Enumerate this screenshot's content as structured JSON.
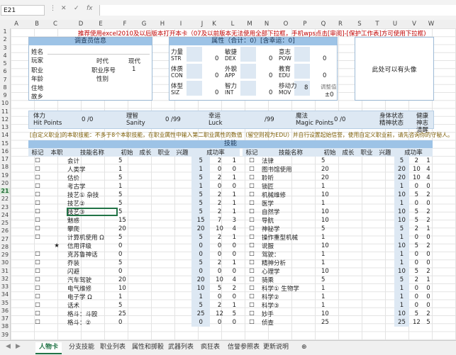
{
  "formula_bar": {
    "name_box": "E21",
    "cancel_icon": "✕",
    "confirm_icon": "✓",
    "fx_label": "fx",
    "formula": ""
  },
  "columns": [
    "A",
    "B",
    "C",
    "D",
    "E",
    "F",
    "G",
    "H",
    "I",
    "J",
    "K",
    "L",
    "M",
    "N",
    "O",
    "P",
    "Q",
    "R",
    "S",
    "T",
    "U",
    "V",
    "W"
  ],
  "rows": [
    "1",
    "2",
    "3",
    "4",
    "5",
    "6",
    "7",
    "8",
    "9",
    "10",
    "11",
    "12",
    "13",
    "14",
    "15",
    "16",
    "17",
    "18",
    "19",
    "20",
    "21",
    "22",
    "23",
    "24",
    "25",
    "26",
    "27",
    "28",
    "29",
    "30",
    "31",
    "32",
    "33",
    "34",
    "35",
    "36",
    "37",
    "38",
    "39"
  ],
  "selected_row": "21",
  "notice": "推荐使用excel2010及以后版本打开本卡（07及以前版本无法使用全部下拉框，手机wps点击[审阅]-[保护工作表]方可使用下拉框)",
  "investigator": {
    "title": "调查员信息",
    "name_label": "姓名",
    "player_label": "玩家",
    "era_label": "时代",
    "era_value": "现代",
    "occupation_label": "职业",
    "occ_seq_label": "职业序号",
    "occ_seq_value": "1",
    "age_label": "年龄",
    "sex_label": "性别",
    "residence_label": "住地",
    "hometown_label": "故乡"
  },
  "attributes": {
    "title": "属性（合计：0）[含幸运：0]",
    "items": [
      {
        "cn": "力量",
        "en": "STR",
        "value": "0"
      },
      {
        "cn": "敏捷",
        "en": "DEX",
        "value": "0"
      },
      {
        "cn": "意志",
        "en": "POW",
        "value": "0"
      },
      {
        "cn": "体质",
        "en": "CON",
        "value": "0"
      },
      {
        "cn": "外貌",
        "en": "APP",
        "value": "0"
      },
      {
        "cn": "教育",
        "en": "EDU",
        "value": "0"
      },
      {
        "cn": "体型",
        "en": "SIZ",
        "value": "0"
      },
      {
        "cn": "智力",
        "en": "INT",
        "value": "0"
      },
      {
        "cn": "移动力",
        "en": "MOV",
        "value": "8"
      }
    ],
    "adjust_label": "调整值",
    "adjust_value": "±0"
  },
  "portrait": {
    "text": "此处可以有头像"
  },
  "status": {
    "hp_cn": "体力",
    "hp_en": "Hit  Points",
    "hp_value": "0 /0",
    "san_cn": "理智",
    "san_en": "Sanity",
    "san_value": "0 /99",
    "luck_cn": "幸运",
    "luck_en": "Luck",
    "luck_value": "/99",
    "mp_cn": "魔法",
    "mp_en": "Magic Points",
    "mp_value": "0 /0",
    "body_label": "身体状态",
    "body_value": "健康",
    "mind_label": "精神状态",
    "mind_value": "神志清醒"
  },
  "custom_notice": "[自定义职业]的本职技能：不多于8个本职技能，在职业属性中输入第二职业属性的数值（留空则视为EDU）并自行设置起始信誉，使用自定义职业前，请先咨询你的守秘人。",
  "skills": {
    "title": "技能",
    "headers": [
      "标记",
      "本职",
      "技能名称",
      "初始",
      "成长",
      "职业",
      "兴趣",
      "成功率"
    ],
    "left": [
      {
        "mark": "☐",
        "occ": "",
        "name": "会计",
        "init": "5",
        "v1": "5",
        "v2": "2",
        "v3": "1"
      },
      {
        "mark": "☐",
        "occ": "",
        "name": "人类学",
        "init": "1",
        "v1": "1",
        "v2": "0",
        "v3": "0"
      },
      {
        "mark": "☐",
        "occ": "",
        "name": "估价",
        "init": "5",
        "v1": "5",
        "v2": "2",
        "v3": "1"
      },
      {
        "mark": "☐",
        "occ": "",
        "name": "考古学",
        "init": "1",
        "v1": "1",
        "v2": "0",
        "v3": "0"
      },
      {
        "mark": "☐",
        "occ": "",
        "name": "技艺① 杂技",
        "init": "5",
        "v1": "5",
        "v2": "2",
        "v3": "1"
      },
      {
        "mark": "☐",
        "occ": "",
        "name": "技艺②",
        "init": "5",
        "v1": "5",
        "v2": "2",
        "v3": "1"
      },
      {
        "mark": "☐",
        "occ": "",
        "name": "技艺③",
        "init": "5",
        "v1": "5",
        "v2": "2",
        "v3": "1"
      },
      {
        "mark": "☐",
        "occ": "",
        "name": "魅惑",
        "init": "15",
        "v1": "15",
        "v2": "7",
        "v3": "3"
      },
      {
        "mark": "☐",
        "occ": "",
        "name": "攀爬",
        "init": "20",
        "v1": "20",
        "v2": "10",
        "v3": "4"
      },
      {
        "mark": "☐",
        "occ": "",
        "name": "计算机使用 Ω",
        "init": "5",
        "v1": "5",
        "v2": "2",
        "v3": "1"
      },
      {
        "mark": "",
        "occ": "★",
        "name": "信用评级",
        "init": "0",
        "v1": "0",
        "v2": "0",
        "v3": "0"
      },
      {
        "mark": "☐",
        "occ": "",
        "name": "克苏鲁神话",
        "init": "0",
        "v1": "0",
        "v2": "0",
        "v3": "0"
      },
      {
        "mark": "☐",
        "occ": "",
        "name": "乔装",
        "init": "5",
        "v1": "5",
        "v2": "2",
        "v3": "1"
      },
      {
        "mark": "☐",
        "occ": "",
        "name": "闪避",
        "init": "0",
        "v1": "0",
        "v2": "0",
        "v3": "0"
      },
      {
        "mark": "☐",
        "occ": "",
        "name": "汽车驾驶",
        "init": "20",
        "v1": "20",
        "v2": "10",
        "v3": "4"
      },
      {
        "mark": "☐",
        "occ": "",
        "name": "电气维修",
        "init": "10",
        "v1": "10",
        "v2": "5",
        "v3": "2"
      },
      {
        "mark": "☐",
        "occ": "",
        "name": "电子学 Ω",
        "init": "1",
        "v1": "1",
        "v2": "0",
        "v3": "0"
      },
      {
        "mark": "☐",
        "occ": "",
        "name": "话术",
        "init": "5",
        "v1": "5",
        "v2": "2",
        "v3": "1"
      },
      {
        "mark": "☐",
        "occ": "",
        "name": "格斗：斗殴",
        "init": "25",
        "v1": "25",
        "v2": "12",
        "v3": "5"
      },
      {
        "mark": "☐",
        "occ": "",
        "name": "格斗：②",
        "init": "0",
        "v1": "0",
        "v2": "0",
        "v3": "0"
      }
    ],
    "right": [
      {
        "mark": "☐",
        "name": "法律",
        "init": "5",
        "v1": "5",
        "v2": "2",
        "v3": "1"
      },
      {
        "mark": "☐",
        "name": "图书馆使用",
        "init": "20",
        "v1": "20",
        "v2": "10",
        "v3": "4"
      },
      {
        "mark": "☐",
        "name": "聆听",
        "init": "20",
        "v1": "20",
        "v2": "10",
        "v3": "4"
      },
      {
        "mark": "☐",
        "name": "锁匠",
        "init": "1",
        "v1": "1",
        "v2": "0",
        "v3": "0"
      },
      {
        "mark": "☐",
        "name": "机械维修",
        "init": "10",
        "v1": "10",
        "v2": "5",
        "v3": "2"
      },
      {
        "mark": "☐",
        "name": "医学",
        "init": "1",
        "v1": "1",
        "v2": "0",
        "v3": "0"
      },
      {
        "mark": "☐",
        "name": "自然学",
        "init": "10",
        "v1": "10",
        "v2": "5",
        "v3": "2"
      },
      {
        "mark": "☐",
        "name": "导航",
        "init": "10",
        "v1": "10",
        "v2": "5",
        "v3": "2"
      },
      {
        "mark": "☐",
        "name": "神秘学",
        "init": "5",
        "v1": "5",
        "v2": "2",
        "v3": "1"
      },
      {
        "mark": "☐",
        "name": "操作重型机械",
        "init": "1",
        "v1": "1",
        "v2": "0",
        "v3": "0"
      },
      {
        "mark": "☐",
        "name": "说服",
        "init": "10",
        "v1": "10",
        "v2": "5",
        "v3": "2"
      },
      {
        "mark": "☐",
        "name": "驾驶：",
        "init": "1",
        "v1": "1",
        "v2": "0",
        "v3": "0"
      },
      {
        "mark": "☐",
        "name": "精神分析",
        "init": "1",
        "v1": "1",
        "v2": "0",
        "v3": "0"
      },
      {
        "mark": "☐",
        "name": "心理学",
        "init": "10",
        "v1": "10",
        "v2": "5",
        "v3": "2"
      },
      {
        "mark": "☐",
        "name": "骑乘",
        "init": "5",
        "v1": "5",
        "v2": "2",
        "v3": "1"
      },
      {
        "mark": "☐",
        "name": "科学① 生物学",
        "init": "1",
        "v1": "1",
        "v2": "0",
        "v3": "0"
      },
      {
        "mark": "☐",
        "name": "科学②",
        "init": "1",
        "v1": "1",
        "v2": "0",
        "v3": "0"
      },
      {
        "mark": "☐",
        "name": "科学③",
        "init": "1",
        "v1": "1",
        "v2": "0",
        "v3": "0"
      },
      {
        "mark": "☐",
        "name": "妙手",
        "init": "10",
        "v1": "10",
        "v2": "5",
        "v3": "2"
      },
      {
        "mark": "☐",
        "name": "侦查",
        "init": "25",
        "v1": "25",
        "v2": "12",
        "v3": "5"
      }
    ]
  },
  "sheet_tabs": [
    "人物卡",
    "分支技能",
    "职业列表",
    "属性和掷骰",
    "武器列表",
    "疯狂表",
    "信誉参照表",
    "更新说明"
  ],
  "active_tab": "人物卡",
  "add_sheet_icon": "⊕",
  "colors": {
    "header_blue": "#9dc3e6",
    "shade": "#dde8f3",
    "accent": "#217346",
    "notice_red": "#c00000"
  }
}
